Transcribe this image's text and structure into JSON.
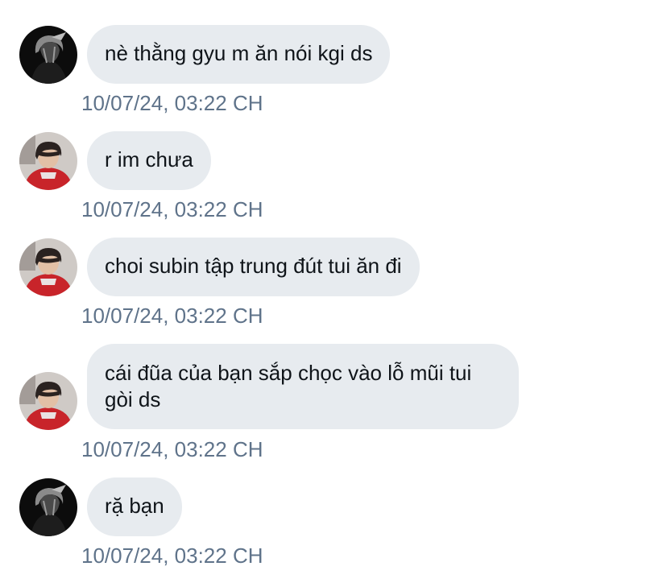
{
  "messages": [
    {
      "avatar": "dark-haired-avatar",
      "text": "nè thằng gyu m ăn nói kgi ds",
      "time": "10/07/24, 03:22 CH"
    },
    {
      "avatar": "red-hoodie-avatar",
      "text": "r im chưa",
      "time": "10/07/24, 03:22 CH"
    },
    {
      "avatar": "red-hoodie-avatar",
      "text": "choi subin tập trung đút tui ăn đi",
      "time": "10/07/24, 03:22 CH"
    },
    {
      "avatar": "red-hoodie-avatar",
      "text": "cái đũa của bạn sắp chọc vào lỗ mũi tui gòi ds",
      "time": "10/07/24, 03:22 CH"
    },
    {
      "avatar": "dark-haired-avatar",
      "text": "rặ bạn",
      "time": "10/07/24, 03:22 CH"
    }
  ],
  "colors": {
    "bubble": "#e7ebef",
    "text": "#0f1419",
    "timestamp": "#5f738a",
    "background": "#ffffff"
  }
}
